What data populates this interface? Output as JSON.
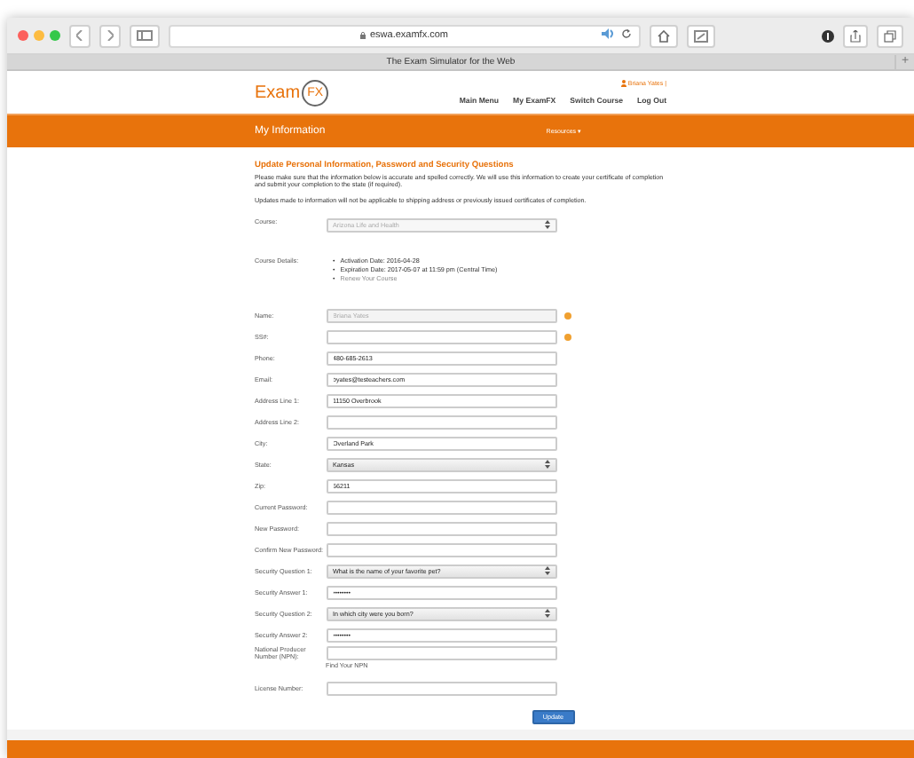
{
  "browser": {
    "url": "eswa.examfx.com",
    "tab_title": "The Exam Simulator for the Web",
    "new_tab": "+"
  },
  "header": {
    "logo_text": "Exam",
    "logo_badge": "FX",
    "user": "Briana Yates |",
    "nav": [
      "Main Menu",
      "My ExamFX",
      "Switch Course",
      "Log Out"
    ]
  },
  "banner": {
    "title": "My Information",
    "menu": "Resources ▾"
  },
  "intro": {
    "heading": "Update Personal Information, Password and Security Questions",
    "paragraphs": [
      "Please make sure that the information below is accurate and spelled correctly. We will use this information to create your certificate of completion and submit your completion to the state (if required).",
      "Updates made to information will not be applicable to shipping address or previously issued certificates of completion."
    ]
  },
  "course": {
    "label": "Course:",
    "value": "Arizona Life and Health",
    "disabled": true
  },
  "course_details": {
    "label": "Course Details:",
    "items": [
      {
        "marker": "•",
        "text": "Activation Date: 2016-04-28",
        "kind": "text"
      },
      {
        "marker": "•",
        "text": "Expiration Date: 2017-05-07 at 11:59 pm (Central Time)",
        "kind": "text"
      },
      {
        "marker": "•",
        "text": "Renew Your Course",
        "kind": "link"
      }
    ]
  },
  "fields": [
    {
      "label": "Name:",
      "kind": "input",
      "value": "Briana Yates",
      "disabled": true,
      "info": true
    },
    {
      "label": "SS#:",
      "kind": "input",
      "info": true
    },
    {
      "label": "Phone:",
      "kind": "input",
      "value": "480-685-2613"
    },
    {
      "label": "Email:",
      "kind": "input",
      "value": "byates@testeachers.com"
    },
    {
      "label": "Address Line 1:",
      "kind": "input",
      "value": "11150 Overbrook"
    },
    {
      "label": "Address Line 2:",
      "kind": "input"
    },
    {
      "label": "City:",
      "kind": "input",
      "value": "Overland Park"
    },
    {
      "label": "State:",
      "kind": "select",
      "value": "Kansas"
    },
    {
      "label": "Zip:",
      "kind": "input",
      "value": "66211"
    },
    {
      "label": "Current Password:",
      "kind": "input"
    },
    {
      "label": "New Password:",
      "kind": "input"
    },
    {
      "label": "Confirm New Password:",
      "kind": "input"
    },
    {
      "label": "Security Question 1:",
      "kind": "select",
      "value": "What is the name of your favorite pet?"
    },
    {
      "label": "Security Answer 1:",
      "kind": "input",
      "value": "••••••••"
    },
    {
      "label": "Security Question 2:",
      "kind": "select",
      "value": "In which city were you born?"
    },
    {
      "label": "Security Answer 2:",
      "kind": "input",
      "value": "••••••••"
    },
    {
      "label": "National Producer Number (NPN):",
      "kind": "input",
      "link": "Find Your NPN"
    },
    {
      "label": "License Number:",
      "kind": "input"
    }
  ],
  "submit": "Update"
}
